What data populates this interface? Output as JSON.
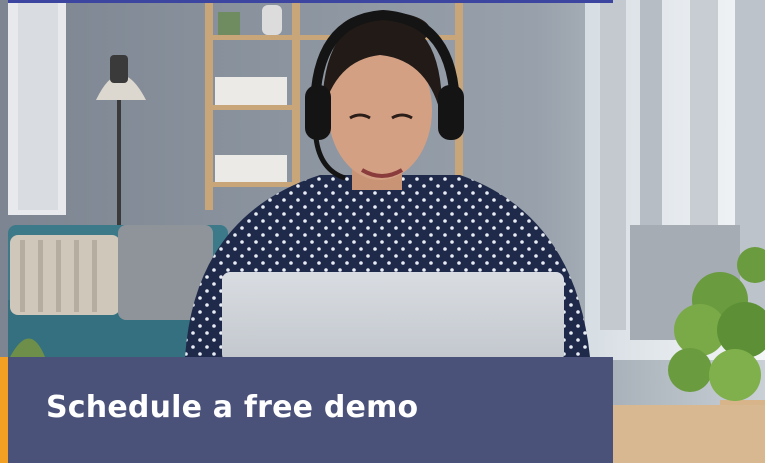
{
  "photo": {
    "description_icon": "woman-headset-laptop-photo"
  },
  "banner": {
    "title": "Schedule a free demo"
  },
  "colors": {
    "banner_bg": "#4b527a",
    "accent_left": "#f2a024",
    "accent_top": "#3c46a0"
  }
}
